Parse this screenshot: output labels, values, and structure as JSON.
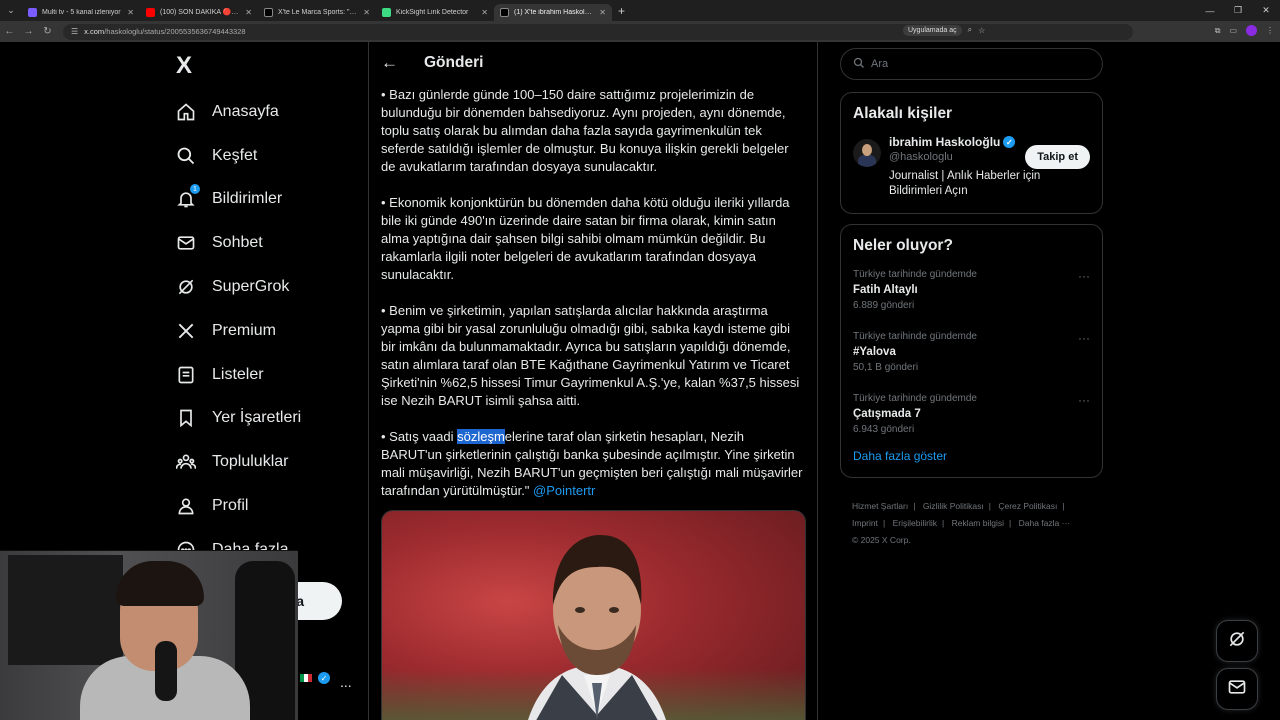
{
  "browser": {
    "tabs": [
      {
        "label": "Multi tv - 5 kanal izleniyor",
        "color": "#7b5cff",
        "active": false
      },
      {
        "label": "(100) SON DAKİKA 🔴Erden",
        "color": "#ff0000",
        "active": false
      },
      {
        "label": "X'te Le Marca Sports: \"Erden Ti",
        "color": "#000000",
        "active": false
      },
      {
        "label": "KickSight Link Detector",
        "color": "#3ddc84",
        "active": false
      },
      {
        "label": "(1) X'te ibrahim Haskoloğlu: \"A",
        "color": "#000000",
        "active": true
      }
    ],
    "new_tab": "+",
    "url_domain": "x.com",
    "url_path": "/haskologlu/status/2005535636749443328",
    "app_button": "Uygulamada aç"
  },
  "nav": {
    "logo": "X",
    "items": [
      {
        "label": "Anasayfa",
        "icon": "home-icon"
      },
      {
        "label": "Keşfet",
        "icon": "search-icon"
      },
      {
        "label": "Bildirimler",
        "icon": "bell-icon",
        "badge": "1"
      },
      {
        "label": "Sohbet",
        "icon": "mail-icon"
      },
      {
        "label": "SuperGrok",
        "icon": "grok-icon"
      },
      {
        "label": "Premium",
        "icon": "x-icon"
      },
      {
        "label": "Listeler",
        "icon": "list-icon"
      },
      {
        "label": "Yer İşaretleri",
        "icon": "bookmark-icon"
      },
      {
        "label": "Topluluklar",
        "icon": "communities-icon"
      },
      {
        "label": "Profil",
        "icon": "profile-icon"
      },
      {
        "label": "Daha fazla",
        "icon": "more-icon"
      }
    ],
    "post_button_partial": "a",
    "account_dots": "..."
  },
  "main": {
    "back": "←",
    "title": "Gönderi",
    "paragraphs": [
      "• Bazı günlerde günde 100–150 daire sattığımız projelerimizin de bulunduğu bir dönemden bahsediyoruz. Aynı projeden, aynı dönemde, toplu satış olarak bu alımdan daha fazla sayıda gayrimenkulün tek seferde satıldığı işlemler de olmuştur. Bu konuya ilişkin gerekli belgeler de avukatlarım tarafından dosyaya sunulacaktır.",
      "• Ekonomik konjonktürün bu dönemden daha kötü olduğu ileriki yıllarda bile iki günde 490'ın üzerinde daire satan bir firma olarak, kimin satın alma yaptığına dair şahsen bilgi sahibi olmam mümkün değildir. Bu rakamlarla ilgili noter belgeleri de avukatlarım tarafından dosyaya sunulacaktır.",
      "• Benim ve şirketimin, yapılan satışlarda alıcılar hakkında araştırma yapma gibi bir yasal zorunluluğu olmadığı gibi, sabıka kaydı isteme gibi bir imkânı da bulunmamaktadır. Ayrıca bu satışların yapıldığı dönemde, satın alımlara taraf olan BTE Kağıthane Gayrimenkul Yatırım ve Ticaret Şirketi'nin %62,5 hissesi Timur Gayrimenkul A.Ş.'ye, kalan %37,5 hissesi ise Nezih BARUT isimli şahsa aitti."
    ],
    "last_paragraph": {
      "before": "• Satış vaadi ",
      "highlight": "sözleşm",
      "after": "elerine taraf olan şirketin hesapları, Nezih BARUT'un şirketlerinin çalıştığı banka şubesinde açılmıştır. Yine şirketin mali müşavirliği, Nezih BARUT'un geçmişten beri çalıştığı mali müşavirler tarafından yürütülmüştür.\" ",
      "mention": "@Pointertr"
    }
  },
  "right": {
    "search_placeholder": "Ara",
    "related_title": "Alakalı kişiler",
    "person": {
      "name": "ibrahim Haskoloğlu",
      "handle": "@haskologlu",
      "bio": "Journalist | Anlık Haberler için Bildirimleri Açın",
      "follow": "Takip et"
    },
    "trends_title": "Neler oluyor?",
    "trends": [
      {
        "context": "Türkiye tarihinde gündemde",
        "name": "Fatih Altaylı",
        "count": "6.889 gönderi"
      },
      {
        "context": "Türkiye tarihinde gündemde",
        "name": "#Yalova",
        "count": "50,1 B gönderi"
      },
      {
        "context": "Türkiye tarihinde gündemde",
        "name": "Çatışmada 7",
        "count": "6.943 gönderi"
      }
    ],
    "show_more": "Daha fazla göster",
    "footer": [
      "Hizmet Şartları",
      "Gizlilik Politikası",
      "Çerez Politikası",
      "Imprint",
      "Erişilebilirlik",
      "Reklam bilgisi",
      "Daha fazla ···",
      "© 2025 X Corp."
    ]
  },
  "colors": {
    "accent": "#1d9bf0",
    "background": "#000000",
    "border": "#2f3336"
  }
}
